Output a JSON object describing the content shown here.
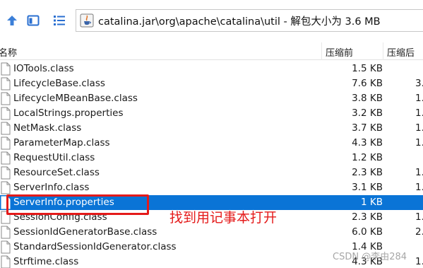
{
  "toolbar": {
    "path": "catalina.jar\\org\\apache\\catalina\\util - 解包大小为 3.6 MB",
    "colors": {
      "up_arrow": "#3b7fd8",
      "folder": "#2a6fd0"
    }
  },
  "columns": {
    "name": "名称",
    "packed": "压缩前",
    "size": "压缩后"
  },
  "files": [
    {
      "name": "IOTools.class",
      "packed": "1.5 KB",
      "size": ""
    },
    {
      "name": "LifecycleBase.class",
      "packed": "7.6 KB",
      "size": "3."
    },
    {
      "name": "LifecycleMBeanBase.class",
      "packed": "3.8 KB",
      "size": "1."
    },
    {
      "name": "LocalStrings.properties",
      "packed": "3.2 KB",
      "size": "1."
    },
    {
      "name": "NetMask.class",
      "packed": "3.7 KB",
      "size": "1."
    },
    {
      "name": "ParameterMap.class",
      "packed": "4.3 KB",
      "size": "1."
    },
    {
      "name": "RequestUtil.class",
      "packed": "1.2 KB",
      "size": ""
    },
    {
      "name": "ResourceSet.class",
      "packed": "2.3 KB",
      "size": "1."
    },
    {
      "name": "ServerInfo.class",
      "packed": "3.1 KB",
      "size": "1."
    },
    {
      "name": "ServerInfo.properties",
      "packed": "1 KB",
      "size": "",
      "selected": true
    },
    {
      "name": "SessionConfig.class",
      "packed": "2.3 KB",
      "size": "1."
    },
    {
      "name": "SessionIdGeneratorBase.class",
      "packed": "6.0 KB",
      "size": "2."
    },
    {
      "name": "StandardSessionIdGenerator.class",
      "packed": "1.4 KB",
      "size": ""
    },
    {
      "name": "Strftime.class",
      "packed": "4.3 KB",
      "size": "1."
    }
  ],
  "annotation": {
    "text": "找到用记事本打开",
    "color": "#e41a1a"
  },
  "watermark": "CSDN @李由284",
  "selection_color": "#0a74d6"
}
